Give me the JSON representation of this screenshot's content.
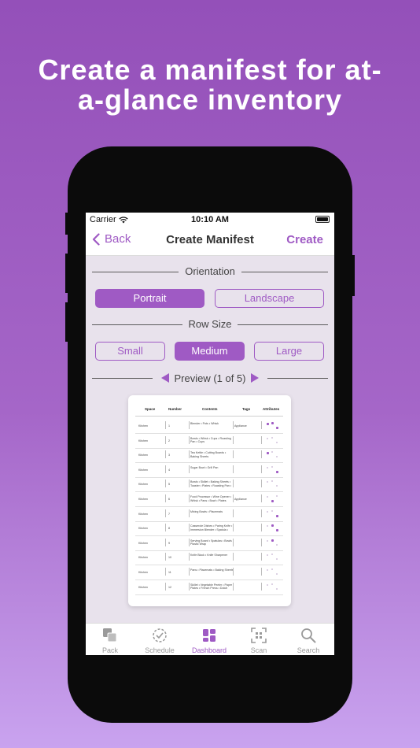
{
  "headline": {
    "line1": "Create a manifest for at-",
    "line2": "a-glance inventory"
  },
  "statusbar": {
    "carrier": "Carrier",
    "time": "10:10 AM"
  },
  "navbar": {
    "back_label": "Back",
    "title": "Create Manifest",
    "action_label": "Create"
  },
  "orientation": {
    "title": "Orientation",
    "options": [
      "Portrait",
      "Landscape"
    ],
    "selected": "Portrait"
  },
  "row_size": {
    "title": "Row Size",
    "options": [
      "Small",
      "Medium",
      "Large"
    ],
    "selected": "Medium"
  },
  "preview": {
    "label": "Preview (1 of 5)"
  },
  "manifest": {
    "columns": [
      "Space",
      "Number",
      "Contents",
      "Tags",
      "Attributes"
    ],
    "rows": [
      {
        "space": "Kitchen",
        "number": "1",
        "contents": "Blender • Pots • Whisk",
        "tags": "Appliance"
      },
      {
        "space": "Kitchen",
        "number": "2",
        "contents": "Bowls • Whisk • Cups • Roasting Pan • Cups",
        "tags": ""
      },
      {
        "space": "Kitchen",
        "number": "3",
        "contents": "Tea Kettle • Cutting Boards • Baking Sheets",
        "tags": ""
      },
      {
        "space": "Kitchen",
        "number": "4",
        "contents": "Sugar Bowl • Grill Pan",
        "tags": ""
      },
      {
        "space": "Kitchen",
        "number": "5",
        "contents": "Bowls • Skillet • Baking Sheets • Toaster • Plates • Roasting Pan •",
        "tags": ""
      },
      {
        "space": "Kitchen",
        "number": "6",
        "contents": "Food Processor • Wine Opener • Whisk • Pans • Bowl • Plates",
        "tags": "Appliance"
      },
      {
        "space": "Kitchen",
        "number": "7",
        "contents": "Mixing Bowls • Placemats",
        "tags": ""
      },
      {
        "space": "Kitchen",
        "number": "8",
        "contents": "Casserole Dishes • Paring Knife • Immersion Blender • Spatula •",
        "tags": ""
      },
      {
        "space": "Kitchen",
        "number": "9",
        "contents": "Serving Board • Spatulas • Bowls • Plastic Wrap",
        "tags": ""
      },
      {
        "space": "Kitchen",
        "number": "10",
        "contents": "Knife Block • Knife Sharpener",
        "tags": ""
      },
      {
        "space": "Kitchen",
        "number": "11",
        "contents": "Pans • Placemats • Baking Sheets",
        "tags": ""
      },
      {
        "space": "Kitchen",
        "number": "12",
        "contents": "Skillet • Vegetable Peeler • Paper Plates • French Press • Dutch",
        "tags": ""
      }
    ]
  },
  "tabbar": {
    "items": [
      {
        "label": "Pack",
        "icon": "pack-icon"
      },
      {
        "label": "Schedule",
        "icon": "schedule-icon"
      },
      {
        "label": "Dashboard",
        "icon": "dashboard-icon"
      },
      {
        "label": "Scan",
        "icon": "scan-icon"
      },
      {
        "label": "Search",
        "icon": "search-icon"
      }
    ],
    "selected": "Dashboard"
  },
  "colors": {
    "accent": "#9f5ac4",
    "background_top": "#9450b9",
    "background_bottom": "#c9a3ef"
  }
}
